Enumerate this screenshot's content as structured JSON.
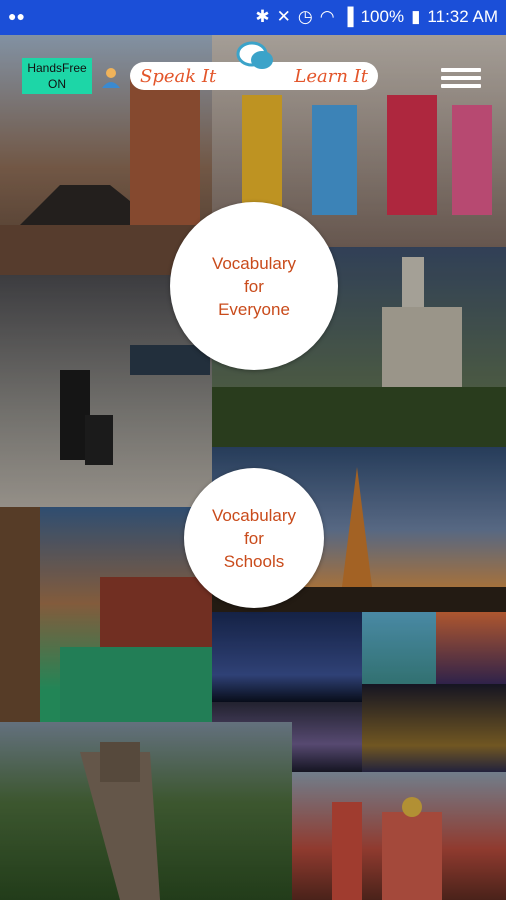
{
  "statusbar": {
    "voicemail_icon": "voicemail-icon",
    "battery": "100%",
    "time": "11:32 AM"
  },
  "header": {
    "handsfree_line1": "HandsFree",
    "handsfree_line2": "ON",
    "logo_left": "Speak It",
    "logo_right": "Learn It"
  },
  "circles": {
    "everyone": "Vocabulary\nfor\nEveryone",
    "schools": "Vocabulary\nfor\nSchools"
  },
  "colors": {
    "statusbar": "#1b4fd8",
    "handsfree": "#1dd6a7",
    "accent": "#e3552a"
  }
}
